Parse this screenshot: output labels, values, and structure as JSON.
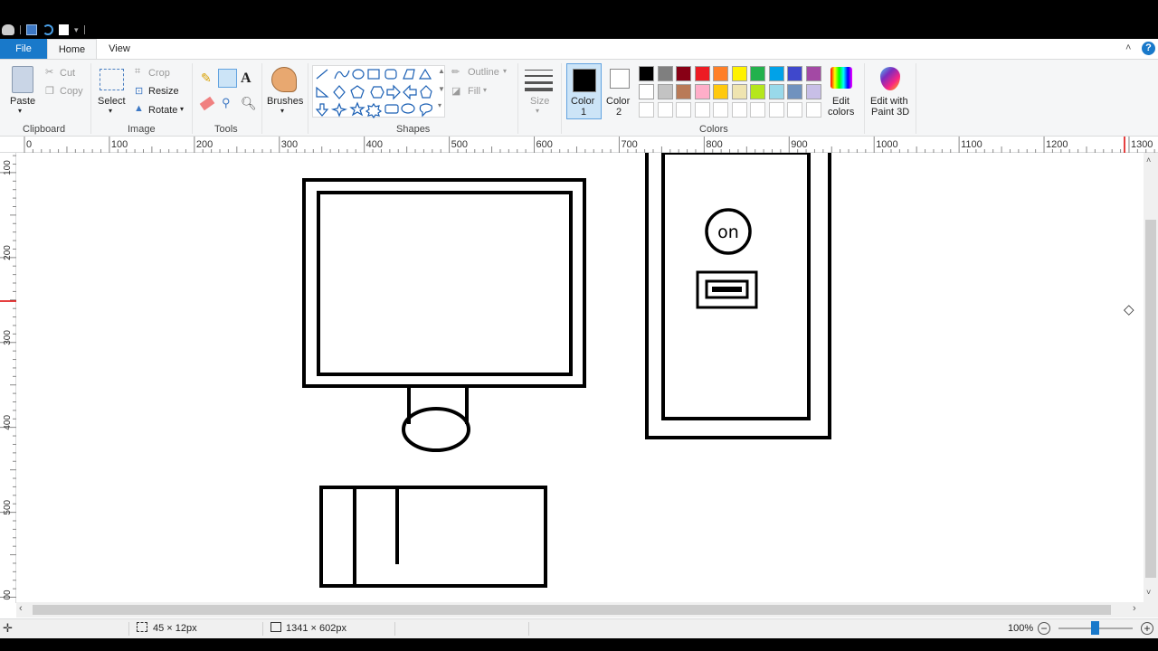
{
  "tabs": {
    "file": "File",
    "home": "Home",
    "view": "View"
  },
  "clipboard": {
    "paste": "Paste",
    "cut": "Cut",
    "copy": "Copy",
    "group": "Clipboard"
  },
  "image": {
    "select": "Select",
    "crop": "Crop",
    "resize": "Resize",
    "rotate": "Rotate",
    "group": "Image"
  },
  "tools": {
    "group": "Tools"
  },
  "brushes": {
    "label": "Brushes"
  },
  "shapes": {
    "outline": "Outline",
    "fill": "Fill",
    "group": "Shapes"
  },
  "size": {
    "label": "Size"
  },
  "colors": {
    "color1": "Color",
    "color1_num": "1",
    "color2": "Color",
    "color2_num": "2",
    "edit_colors_1": "Edit",
    "edit_colors_2": "colors",
    "edit_paint3d_1": "Edit with",
    "edit_paint3d_2": "Paint 3D",
    "group": "Colors",
    "color1_value": "#000000",
    "color2_value": "#ffffff",
    "palette_row1": [
      "#000000",
      "#7f7f7f",
      "#880015",
      "#ed1c24",
      "#ff7f27",
      "#fff200",
      "#22b14c",
      "#00a2e8",
      "#3f48cc",
      "#a349a4"
    ],
    "palette_row2": [
      "#ffffff",
      "#c3c3c3",
      "#b97a57",
      "#ffaec9",
      "#ffc90e",
      "#efe4b0",
      "#b5e61d",
      "#99d9ea",
      "#7092be",
      "#c8bfe7"
    ],
    "palette_row3": [
      "#ffffff",
      "#ffffff",
      "#ffffff",
      "#ffffff",
      "#ffffff",
      "#ffffff",
      "#ffffff",
      "#ffffff",
      "#ffffff",
      "#ffffff"
    ]
  },
  "ruler": {
    "h_labels": [
      "0",
      "100",
      "200",
      "300",
      "400",
      "500",
      "600",
      "700",
      "800",
      "900",
      "1000",
      "1100",
      "1200",
      "1300"
    ],
    "v_labels": [
      "100",
      "200",
      "300",
      "400",
      "500",
      "00"
    ]
  },
  "canvas": {
    "power_label": "on"
  },
  "status": {
    "selection_size": "45 × 12px",
    "image_size": "1341 × 602px",
    "zoom": "100%"
  }
}
